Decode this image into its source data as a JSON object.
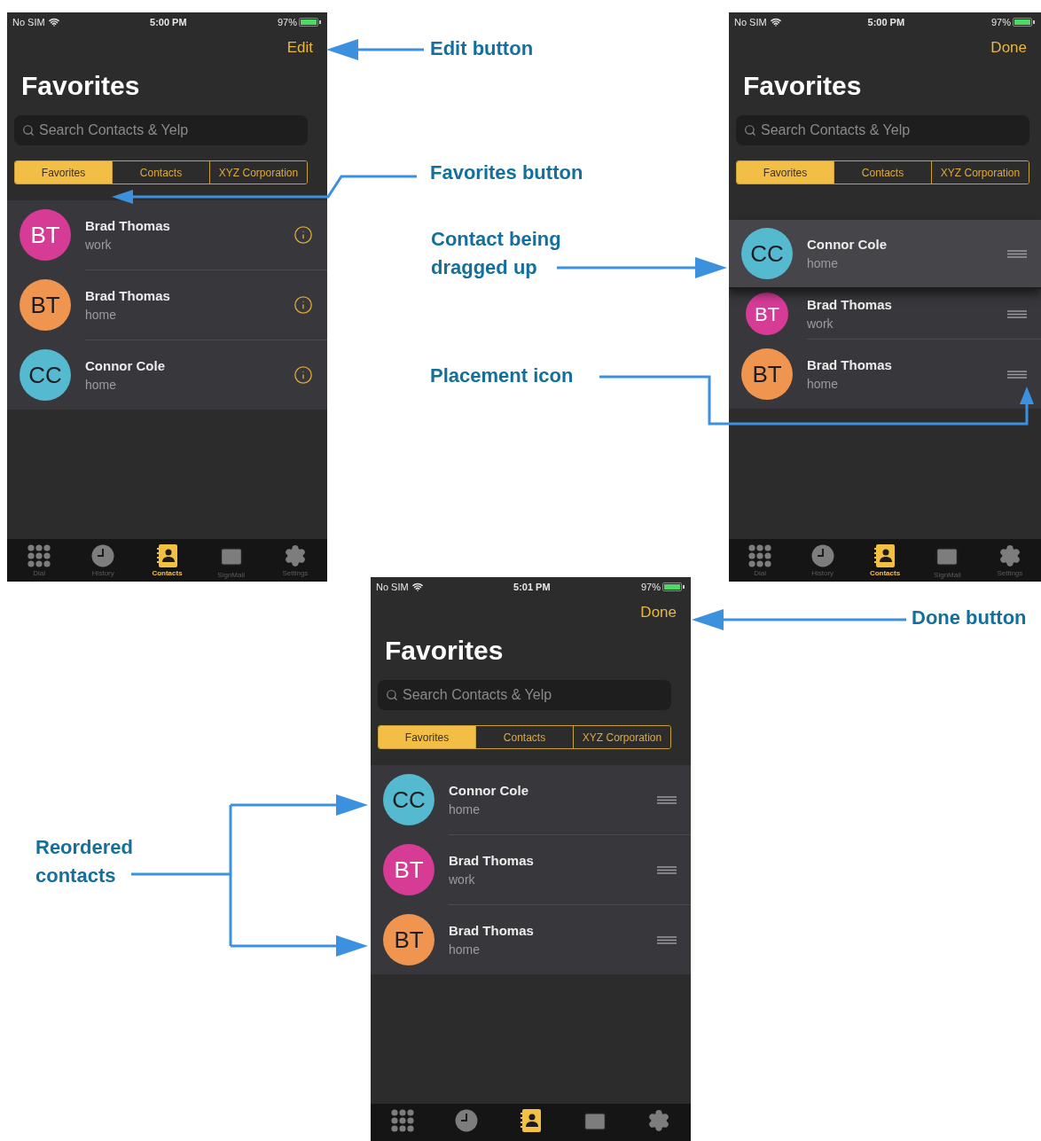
{
  "phones": [
    {
      "kind": "browse",
      "status": {
        "carrier": "No SIM",
        "time": "5:00 PM",
        "battery": "97%"
      },
      "nav_button": "Edit",
      "title": "Favorites",
      "search": {
        "placeholder": "Search Contacts & Yelp"
      },
      "segments": [
        {
          "label": "Favorites",
          "selected": true
        },
        {
          "label": "Contacts",
          "selected": false
        },
        {
          "label": "XYZ Corporation",
          "selected": false
        }
      ],
      "rows": [
        {
          "initials": "BT",
          "name": "Brad Thomas",
          "detail": "work",
          "color": "#d63b96",
          "dragging": false
        },
        {
          "initials": "BT",
          "name": "Brad Thomas",
          "detail": "home",
          "color": "#ef9550",
          "dragging": false
        },
        {
          "initials": "CC",
          "name": "Connor Cole",
          "detail": "home",
          "color": "#55b9d0",
          "dragging": false
        }
      ],
      "tabbar": [
        {
          "label": "Dial",
          "selected": false
        },
        {
          "label": "History",
          "selected": false
        },
        {
          "label": "Contacts",
          "selected": true
        },
        {
          "label": "SignMail",
          "selected": false
        },
        {
          "label": "Settings",
          "selected": false
        }
      ]
    },
    {
      "kind": "edit",
      "status": {
        "carrier": "No SIM",
        "time": "5:00 PM",
        "battery": "97%"
      },
      "nav_button": "Done",
      "title": "Favorites",
      "search": {
        "placeholder": "Search Contacts & Yelp"
      },
      "segments": [
        {
          "label": "Favorites",
          "selected": true
        },
        {
          "label": "Contacts",
          "selected": false
        },
        {
          "label": "XYZ Corporation",
          "selected": false
        }
      ],
      "rows": [
        {
          "initials": "CC",
          "name": "Connor Cole",
          "detail": "home",
          "color": "#55b9d0",
          "dragging": true
        },
        {
          "initials": "BT",
          "name": "Brad Thomas",
          "detail": "work",
          "color": "#d63b96",
          "dragging": false
        },
        {
          "initials": "BT",
          "name": "Brad Thomas",
          "detail": "home",
          "color": "#ef9550",
          "dragging": false
        }
      ],
      "tabbar": [
        {
          "label": "Dial",
          "selected": false
        },
        {
          "label": "History",
          "selected": false
        },
        {
          "label": "Contacts",
          "selected": true
        },
        {
          "label": "SignMail",
          "selected": false
        },
        {
          "label": "Settings",
          "selected": false
        }
      ]
    },
    {
      "kind": "edit",
      "status": {
        "carrier": "No SIM",
        "time": "5:01 PM",
        "battery": "97%"
      },
      "nav_button": "Done",
      "title": "Favorites",
      "search": {
        "placeholder": "Search Contacts & Yelp"
      },
      "segments": [
        {
          "label": "Favorites",
          "selected": true
        },
        {
          "label": "Contacts",
          "selected": false
        },
        {
          "label": "XYZ Corporation",
          "selected": false
        }
      ],
      "rows": [
        {
          "initials": "CC",
          "name": "Connor Cole",
          "detail": "home",
          "color": "#55b9d0",
          "dragging": false
        },
        {
          "initials": "BT",
          "name": "Brad Thomas",
          "detail": "work",
          "color": "#d63b96",
          "dragging": false
        },
        {
          "initials": "BT",
          "name": "Brad Thomas",
          "detail": "home",
          "color": "#ef9550",
          "dragging": false
        }
      ],
      "tabbar": [
        {
          "selected": false
        },
        {
          "selected": false
        },
        {
          "selected": true
        },
        {
          "selected": false
        },
        {
          "selected": false
        }
      ]
    }
  ],
  "callouts": [
    {
      "text": "Edit button"
    },
    {
      "text": "Favorites button"
    },
    {
      "text": "Contact being dragged up"
    },
    {
      "text": "Placement icon"
    },
    {
      "text": "Done button"
    },
    {
      "text": "Reordered contacts"
    }
  ]
}
